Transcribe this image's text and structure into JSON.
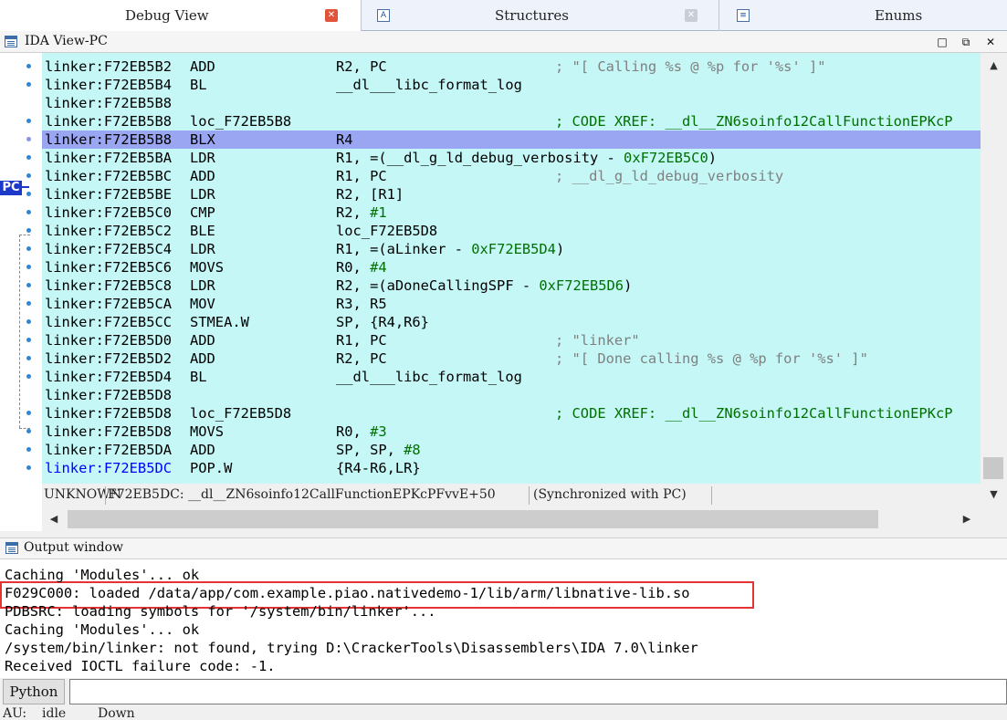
{
  "tabs": [
    {
      "label": "Debug View",
      "active": true
    },
    {
      "label": "Structures",
      "active": false
    },
    {
      "label": "Enums",
      "active": false
    }
  ],
  "ida_view": {
    "title": "IDA View-PC",
    "pc_marker": "PC",
    "lines": [
      {
        "addr": "linker:F72EB5B2",
        "mnem": "ADD",
        "ops": "R2, PC",
        "comment": "; \"[ Calling %s @ %p for '%s' ]\""
      },
      {
        "addr": "linker:F72EB5B4",
        "mnem": "BL",
        "ops": "__dl___libc_format_log",
        "comment": ""
      },
      {
        "addr": "linker:F72EB5B8",
        "mnem": "",
        "ops": "",
        "comment": ""
      },
      {
        "addr": "linker:F72EB5B8",
        "label": "loc_F72EB5B8",
        "comment": "; CODE XREF: __dl__ZN6soinfo12CallFunctionEPKcP"
      },
      {
        "addr": "linker:F72EB5B8",
        "mnem": "BLX",
        "ops": "R4",
        "comment": ""
      },
      {
        "addr": "linker:F72EB5BA",
        "mnem": "LDR",
        "ops": "R1, =(__dl_g_ld_debug_verbosity - ",
        "num": "0xF72EB5C0",
        "ops_tail": ")",
        "comment": ""
      },
      {
        "addr": "linker:F72EB5BC",
        "mnem": "ADD",
        "ops": "R1, PC",
        "comment": "; __dl_g_ld_debug_verbosity"
      },
      {
        "addr": "linker:F72EB5BE",
        "mnem": "LDR",
        "ops": "R2, [R1]",
        "comment": ""
      },
      {
        "addr": "linker:F72EB5C0",
        "mnem": "CMP",
        "ops": "R2, ",
        "num": "#1",
        "comment": ""
      },
      {
        "addr": "linker:F72EB5C2",
        "mnem": "BLE",
        "ops": "loc_F72EB5D8",
        "comment": ""
      },
      {
        "addr": "linker:F72EB5C4",
        "mnem": "LDR",
        "ops": "R1, =(aLinker - ",
        "num": "0xF72EB5D4",
        "ops_tail": ")",
        "comment": ""
      },
      {
        "addr": "linker:F72EB5C6",
        "mnem": "MOVS",
        "ops": "R0, ",
        "num": "#4",
        "comment": ""
      },
      {
        "addr": "linker:F72EB5C8",
        "mnem": "LDR",
        "ops": "R2, =(aDoneCallingSPF - ",
        "num": "0xF72EB5D6",
        "ops_tail": ")",
        "comment": ""
      },
      {
        "addr": "linker:F72EB5CA",
        "mnem": "MOV",
        "ops": "R3, R5",
        "comment": ""
      },
      {
        "addr": "linker:F72EB5CC",
        "mnem": "STMEA.W",
        "ops": "SP, {R4,R6}",
        "comment": ""
      },
      {
        "addr": "linker:F72EB5D0",
        "mnem": "ADD",
        "ops": "R1, PC",
        "comment": "; \"linker\""
      },
      {
        "addr": "linker:F72EB5D2",
        "mnem": "ADD",
        "ops": "R2, PC",
        "comment": "; \"[ Done calling %s @ %p for '%s' ]\""
      },
      {
        "addr": "linker:F72EB5D4",
        "mnem": "BL",
        "ops": "__dl___libc_format_log",
        "comment": ""
      },
      {
        "addr": "linker:F72EB5D8",
        "mnem": "",
        "ops": "",
        "comment": ""
      },
      {
        "addr": "linker:F72EB5D8",
        "label": "loc_F72EB5D8",
        "comment": "; CODE XREF: __dl__ZN6soinfo12CallFunctionEPKcP"
      },
      {
        "addr": "linker:F72EB5D8",
        "mnem": "MOVS",
        "ops": "R0, ",
        "num": "#3",
        "comment": ""
      },
      {
        "addr": "linker:F72EB5DA",
        "mnem": "ADD",
        "ops": "SP, SP, ",
        "num": "#8",
        "comment": ""
      },
      {
        "addr": "linker:F72EB5DC",
        "mnem": "POP.W",
        "ops": "{R4-R6,LR}",
        "comment": ""
      }
    ],
    "status": {
      "segment": "UNKNOWN",
      "location": "F72EB5DC: __dl__ZN6soinfo12CallFunctionEPKcPFvvE+50",
      "sync": "(Synchronized with PC)"
    }
  },
  "output": {
    "title": "Output window",
    "lines": [
      "Caching 'Modules'... ok",
      "F029C000: loaded /data/app/com.example.piao.nativedemo-1/lib/arm/libnative-lib.so",
      "PDBSRC: loading symbols for '/system/bin/linker'...",
      "Caching 'Modules'... ok",
      "/system/bin/linker: not found, trying D:\\CrackerTools\\Disassemblers\\IDA 7.0\\linker",
      "Received IOCTL failure code: -1."
    ]
  },
  "python_bar": {
    "button_label": "Python",
    "input_value": ""
  },
  "statusbar": {
    "au_label": "AU:",
    "au_state": "idle",
    "direction": "Down"
  },
  "colors": {
    "code_bg": "#c4f7f6",
    "pc_line": "#9ba6f2",
    "pc_marker": "#1d39c9",
    "highlight_border": "#e33333",
    "numeric": "#007000",
    "comment": "#808080"
  }
}
